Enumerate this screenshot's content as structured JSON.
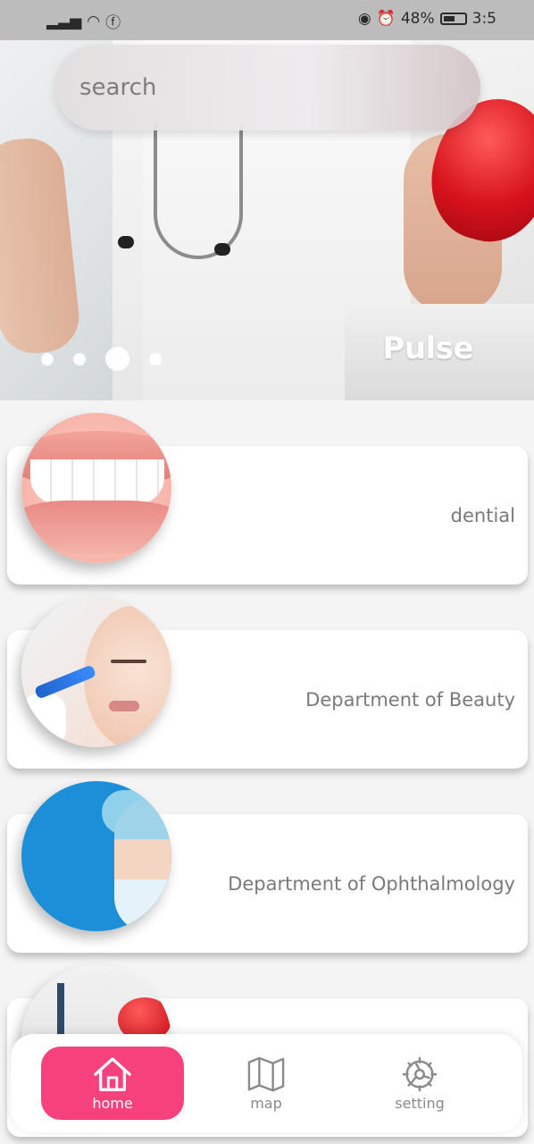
{
  "status_bar": {
    "signal": "⁴⁶",
    "battery": "48%",
    "time": "3:5"
  },
  "search": {
    "placeholder": "search"
  },
  "hero": {
    "title": "Pulse",
    "active_slide": 3,
    "slide_count": 4
  },
  "departments": [
    {
      "label": "dential"
    },
    {
      "label": "Department of Beauty"
    },
    {
      "label": "Department of Ophthalmology"
    },
    {
      "label": ""
    }
  ],
  "nav": {
    "items": [
      {
        "label": "home",
        "icon": "home-icon",
        "active": true
      },
      {
        "label": "map",
        "icon": "map-icon",
        "active": false
      },
      {
        "label": "setting",
        "icon": "gear-icon",
        "active": false
      }
    ]
  },
  "colors": {
    "accent": "#f6417d",
    "card_text": "#7a7a7a"
  }
}
